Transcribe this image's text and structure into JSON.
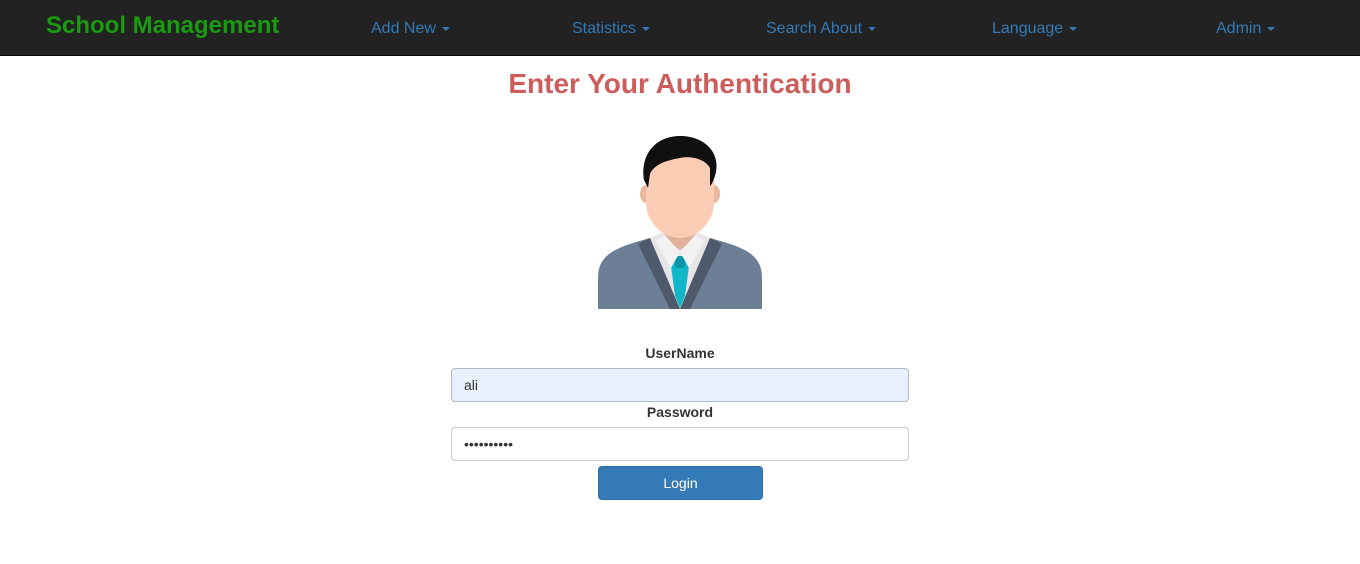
{
  "navbar": {
    "brand": "School Management",
    "items": [
      {
        "label": "Add New"
      },
      {
        "label": "Statistics"
      },
      {
        "label": "Search About"
      },
      {
        "label": "Language"
      },
      {
        "label": "Admin"
      }
    ]
  },
  "page": {
    "title": "Enter Your Authentication"
  },
  "avatar": {
    "icon": "user-avatar-icon"
  },
  "form": {
    "username_label": "UserName",
    "username_value": "ali",
    "password_label": "Password",
    "password_value": "••••••••••",
    "login_label": "Login"
  },
  "colors": {
    "navbar_bg": "#222222",
    "brand": "#199b10",
    "nav_link": "#337ab7",
    "title": "#cd5c5c",
    "button": "#337ab7",
    "autofill_bg": "#e8f0fe"
  }
}
